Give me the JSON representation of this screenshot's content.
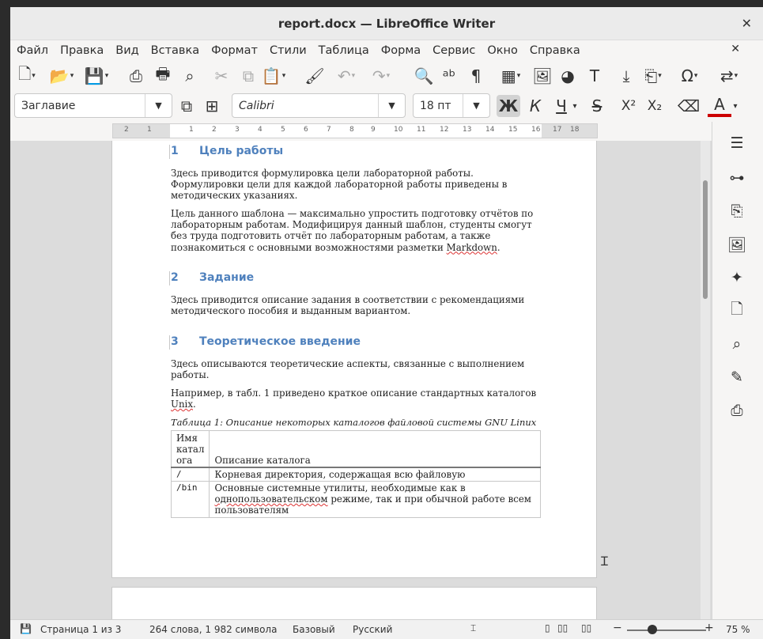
{
  "window": {
    "title": "report.docx — LibreOffice Writer",
    "close_glyph": "✕"
  },
  "menu": [
    "Файл",
    "Правка",
    "Вид",
    "Вставка",
    "Формат",
    "Стили",
    "Таблица",
    "Форма",
    "Сервис",
    "Окно",
    "Справка"
  ],
  "toolbar": {
    "paragraph_style": "Заглавие",
    "font_name": "Calibri",
    "font_size": "18 пт",
    "bold": "Ж",
    "italic": "К",
    "underline": "Ч",
    "strike": "S",
    "superscript": "X²",
    "subscript": "X₂",
    "font_color": "A",
    "font_color_hex": "#cc0000"
  },
  "ruler": {
    "labels": [
      "2",
      "1",
      "1",
      "2",
      "3",
      "4",
      "5",
      "6",
      "7",
      "8",
      "9",
      "10",
      "11",
      "12",
      "13",
      "14",
      "15",
      "16",
      "17",
      "18"
    ]
  },
  "document": {
    "section1": {
      "num": "1",
      "title": "Цель работы"
    },
    "p1": "Здесь приводится формулировка цели лабораторной работы. Формулировки цели для каждой лабораторной работы приведены в методических указаниях.",
    "p2_a": "Цель данного шаблона — максимально упростить подготовку отчётов по лабораторным работам. Модифицируя данный шаблон, студенты смогут без труда подготовить отчёт по лабораторным работам, а также познакомиться с основными возможностями разметки ",
    "p2_b": "Markdown",
    "p2_c": ".",
    "section2": {
      "num": "2",
      "title": "Задание"
    },
    "p3": "Здесь приводится описание задания в соответствии с рекомендациями методического пособия и выданным вариантом.",
    "section3": {
      "num": "3",
      "title": "Теоретическое введение"
    },
    "p4": "Здесь описываются теоретические аспекты, связанные с выполнением работы.",
    "p5_a": "Например, в табл. 1 приведено краткое описание стандартных каталогов ",
    "p5_b": "Unix",
    "p5_c": ".",
    "caption": "Таблица 1: Описание некоторых каталогов файловой системы GNU Linux",
    "table": {
      "col1": "Имя катал ога",
      "col2": "Описание каталога",
      "r1c1": "/",
      "r1c2": "Корневая директория, содержащая всю файловую",
      "r2c1": "/bin",
      "r2c2_a": "Основные системные утилиты, необходимые как в ",
      "r2c2_b": "однопользовательском",
      "r2c2_c": " режиме, так и при обычной работе всем пользователям"
    }
  },
  "status": {
    "page": "Страница 1 из 3",
    "words": "264 слова, 1 982 символа",
    "style": "Базовый",
    "lang": "Русский",
    "zoom": "75 %",
    "zoom_minus": "−",
    "zoom_plus": "+"
  }
}
